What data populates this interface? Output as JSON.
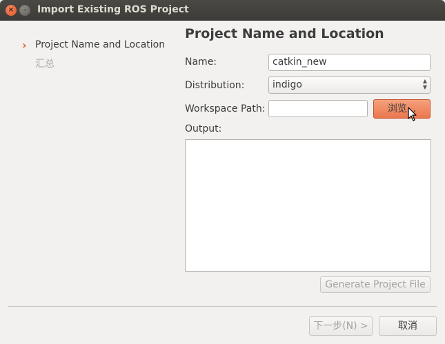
{
  "window": {
    "title": "Import Existing ROS Project"
  },
  "sidebar": {
    "items": [
      {
        "label": "Project Name and Location",
        "active": true
      },
      {
        "label": "汇总",
        "active": false
      }
    ]
  },
  "main": {
    "heading": "Project Name and Location",
    "name_label": "Name:",
    "name_value": "catkin_new",
    "distribution_label": "Distribution:",
    "distribution_value": "indigo",
    "workspace_label": "Workspace Path:",
    "workspace_value": "",
    "browse_label": "浏览...",
    "output_label": "Output:",
    "generate_label": "Generate Project File"
  },
  "footer": {
    "next_label": "下一步(N) >",
    "cancel_label": "取消"
  },
  "colors": {
    "accent": "#ea774e",
    "titlebar": "#3c3b37",
    "background": "#f2f1f0"
  }
}
